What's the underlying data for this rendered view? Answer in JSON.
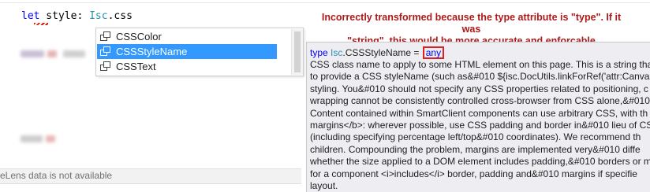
{
  "editor": {
    "code": {
      "keyword": "let",
      "variable": " style: ",
      "type": "Isc",
      "member": ".css"
    }
  },
  "annotation": {
    "line1": "Incorrectly transformed because the type attribute is \"type\". If it was",
    "line2": "\"string\", this would be more accurate and enforcable"
  },
  "completion": {
    "items": [
      {
        "label": "CSSColor",
        "icon": "class-icon",
        "selected": false
      },
      {
        "label": "CSSStyleName",
        "icon": "class-icon",
        "selected": true
      },
      {
        "label": "CSSText",
        "icon": "class-icon",
        "selected": false
      }
    ]
  },
  "tooltip": {
    "sig_keyword": "type",
    "sig_type": "Isc",
    "sig_name": ".CSSStyleName = ",
    "sig_value": "any",
    "lines": [
      "CSS class name to apply to some HTML element on this page. This is a string that",
      "to provide a CSS styleName (such as&#010 ${isc.DocUtils.linkForRef('attr:Canvas.s",
      "styling.  You&#010 should not specify any CSS properties related to positioning, c",
      "wrapping cannot be consistently controlled cross-browser from CSS alone,&#010 t",
      "Content contained within SmartClient components can use arbitrary CSS, with th",
      "margins</b>: wherever possible, use CSS padding and border in&#010 lieu of CS",
      "(including specifying percentage left/top&#010 coordinates).  We recommend th",
      "children.  Compounding the problem, margins are implemented very&#010 diffe",
      "whether the size applied to a DOM element includes padding,&#010 borders or m",
      "for a component <i>includes</i> border, padding and&#010 margins if specifie",
      "layout."
    ]
  },
  "status": {
    "codelens": "eLens data is not available"
  },
  "colors": {
    "annotation": "#b01818",
    "selection": "#3399ff",
    "highlight_box": "#e02020",
    "keyword": "#0000ff",
    "type": "#2b91af"
  }
}
